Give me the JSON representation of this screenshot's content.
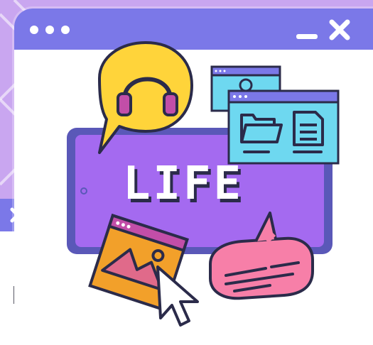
{
  "main_window": {
    "center_word": "LIFE"
  },
  "back_window": {
    "partial_text": "И"
  },
  "colors": {
    "background": "#c9a6f0",
    "titlebar": "#7b78e8",
    "tablet_frame": "#5a58b8",
    "tablet_screen": "#a46af0",
    "speech_yellow": "#ffd43a",
    "folder_panel": "#6ed8f0",
    "photo_orange": "#f2a02a",
    "chat_pink": "#f77fa8"
  },
  "icons": {
    "window_dots": "three-dots-icon",
    "minimize": "minimize-icon",
    "close": "close-icon",
    "headphones": "headphones-icon",
    "user": "user-icon",
    "folder": "folder-icon",
    "document": "document-icon",
    "image": "image-icon",
    "cursor": "cursor-icon",
    "chat": "chat-bubble-icon"
  }
}
